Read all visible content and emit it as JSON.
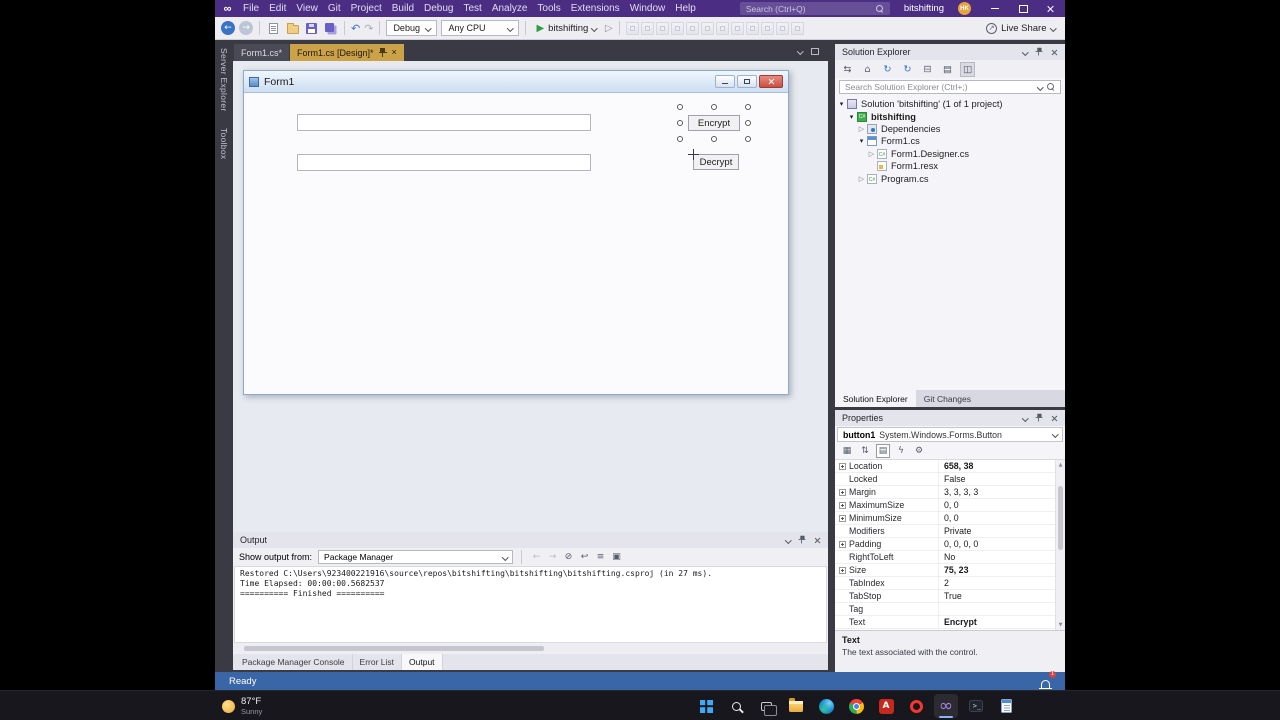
{
  "colors": {
    "titlebar": "#4B2E83",
    "toolbar-bg": "#EEEEF2",
    "shell-dark": "#3A3A44",
    "tab-active": "#CBA24A",
    "panel-bg": "#F5F5F9",
    "status": "#3A66A8",
    "run-green": "#2E9E44",
    "close-red": "#C94F44",
    "avatar-orange": "#E8A33D"
  },
  "titlebar": {
    "menus": [
      "File",
      "Edit",
      "View",
      "Git",
      "Project",
      "Build",
      "Debug",
      "Test",
      "Analyze",
      "Tools",
      "Extensions",
      "Window",
      "Help"
    ],
    "search_placeholder": "Search (Ctrl+Q)",
    "solution_name": "bitshifting",
    "avatar_initials": "HK"
  },
  "toolbar": {
    "config_dropdown": "Debug",
    "platform_dropdown": "Any CPU",
    "run_label": "bitshifting",
    "live_share_label": "Live Share",
    "designer_icons": [
      "align-lefts",
      "align-centers",
      "align-rights",
      "align-tops",
      "align-middles",
      "align-bottoms",
      "make-same-width",
      "make-same-height",
      "horizontal-spacing",
      "vertical-spacing",
      "bring-to-front",
      "send-to-back"
    ]
  },
  "side_tabs": [
    "Server Explorer",
    "Toolbox"
  ],
  "doc_tabs": [
    {
      "label": "Form1.cs*",
      "active": false
    },
    {
      "label": "Form1.cs [Design]*",
      "active": true
    }
  ],
  "designer": {
    "form_title": "Form1",
    "encrypt_button": "Encrypt",
    "decrypt_button": "Decrypt"
  },
  "solution_explorer": {
    "title": "Solution Explorer",
    "toolbar_icons": [
      "switch-views",
      "home",
      "refresh",
      "sync",
      "collapse-all",
      "properties",
      "preview-selected-items"
    ],
    "search_placeholder": "Search Solution Explorer (Ctrl+;)",
    "tree": [
      {
        "label": "Solution 'bitshifting' (1 of 1 project)",
        "indent": 0,
        "icon": "solution",
        "expander": "expanded"
      },
      {
        "label": "bitshifting",
        "indent": 1,
        "icon": "project",
        "expander": "expanded",
        "bold": true
      },
      {
        "label": "Dependencies",
        "indent": 2,
        "icon": "dependencies",
        "expander": "collapsed"
      },
      {
        "label": "Form1.cs",
        "indent": 2,
        "icon": "form",
        "expander": "expanded"
      },
      {
        "label": "Form1.Designer.cs",
        "indent": 3,
        "icon": "cs-file",
        "expander": "collapsed"
      },
      {
        "label": "Form1.resx",
        "indent": 3,
        "icon": "resx-file",
        "expander": "none"
      },
      {
        "label": "Program.cs",
        "indent": 2,
        "icon": "cs-file",
        "expander": "collapsed"
      }
    ],
    "bottom_tabs": [
      {
        "label": "Solution Explorer",
        "active": true
      },
      {
        "label": "Git Changes",
        "active": false
      }
    ]
  },
  "properties": {
    "title": "Properties",
    "object_name": "button1",
    "object_type": "System.Windows.Forms.Button",
    "toolbar_icons": [
      "categorized",
      "alphabetical",
      "properties",
      "events",
      "property-pages"
    ],
    "rows": [
      {
        "name": "Location",
        "value": "658, 38",
        "expandable": true,
        "bold": true
      },
      {
        "name": "Locked",
        "value": "False"
      },
      {
        "name": "Margin",
        "value": "3, 3, 3, 3",
        "expandable": true
      },
      {
        "name": "MaximumSize",
        "value": "0, 0",
        "expandable": true
      },
      {
        "name": "MinimumSize",
        "value": "0, 0",
        "expandable": true
      },
      {
        "name": "Modifiers",
        "value": "Private"
      },
      {
        "name": "Padding",
        "value": "0, 0, 0, 0",
        "expandable": true
      },
      {
        "name": "RightToLeft",
        "value": "No"
      },
      {
        "name": "Size",
        "value": "75, 23",
        "expandable": true,
        "bold": true
      },
      {
        "name": "TabIndex",
        "value": "2"
      },
      {
        "name": "TabStop",
        "value": "True"
      },
      {
        "name": "Tag",
        "value": ""
      },
      {
        "name": "Text",
        "value": "Encrypt",
        "bold": true
      }
    ],
    "description_title": "Text",
    "description_text": "The text associated with the control."
  },
  "output": {
    "title": "Output",
    "show_output_from_label": "Show output from:",
    "source_dropdown": "Package Manager",
    "toolbar_icons": [
      "previous-message",
      "next-message",
      "clear-all",
      "word-wrap",
      "messages-list",
      "toggle-output"
    ],
    "lines": [
      "Restored C:\\Users\\923400221916\\source\\repos\\bitshifting\\bitshifting\\bitshifting.csproj (in 27 ms).",
      "Time Elapsed: 00:00:00.5682537",
      "========== Finished =========="
    ],
    "bottom_tabs": [
      {
        "label": "Package Manager Console",
        "active": false
      },
      {
        "label": "Error List",
        "active": false
      },
      {
        "label": "Output",
        "active": true
      }
    ]
  },
  "statusbar": {
    "text": "Ready",
    "notification_count": "1"
  },
  "taskbar": {
    "weather_temp": "87°F",
    "weather_desc": "Sunny",
    "icons": [
      {
        "name": "start"
      },
      {
        "name": "search"
      },
      {
        "name": "task-view"
      },
      {
        "name": "file-explorer"
      },
      {
        "name": "edge"
      },
      {
        "name": "chrome"
      },
      {
        "name": "acrobat"
      },
      {
        "name": "opera"
      },
      {
        "name": "visual-studio",
        "active": true
      },
      {
        "name": "terminal"
      },
      {
        "name": "notepad"
      }
    ]
  }
}
